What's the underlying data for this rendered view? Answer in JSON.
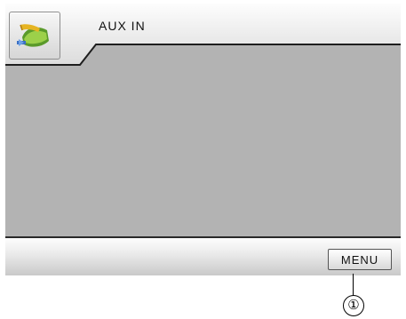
{
  "header": {
    "title": "AUX IN",
    "icon": "aux-input-plug-icon"
  },
  "bottom_bar": {
    "menu_label": "MENU"
  },
  "callout": {
    "number": "①"
  },
  "colors": {
    "screen_bg": "#b3b3b3",
    "bar_light": "#fdfdfd",
    "text": "#111111"
  }
}
